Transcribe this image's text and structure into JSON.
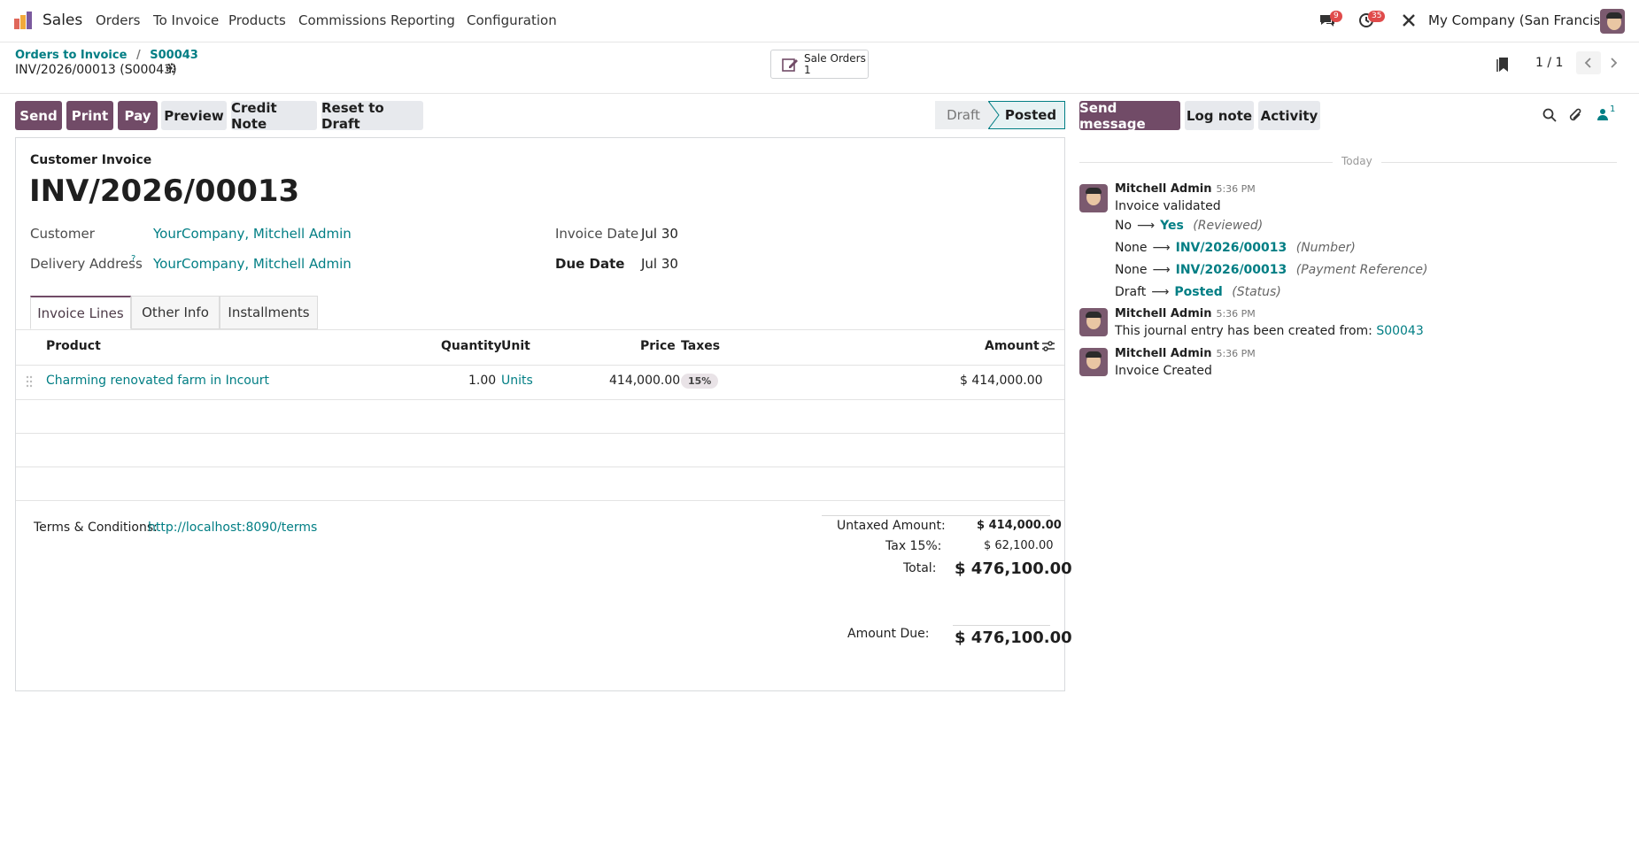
{
  "navbar": {
    "app_name": "Sales",
    "menu": [
      "Orders",
      "To Invoice",
      "Products",
      "Commissions",
      "Reporting",
      "Configuration"
    ],
    "messages_badge": "9",
    "activity_badge": "35",
    "company": "My Company (San Francisco)"
  },
  "breadcrumb": {
    "root": "Orders to Invoice",
    "separator": "/",
    "parent": "S00043",
    "current": "INV/2026/00013 (S00043)"
  },
  "smart_button": {
    "label": "Sale Orders",
    "count": "1"
  },
  "pager": {
    "value": "1 / 1"
  },
  "actions": {
    "send": "Send",
    "print": "Print",
    "pay": "Pay",
    "preview": "Preview",
    "credit_note": "Credit Note",
    "reset": "Reset to Draft"
  },
  "statusbar": {
    "draft": "Draft",
    "posted": "Posted"
  },
  "form": {
    "type_label": "Customer Invoice",
    "name": "INV/2026/00013",
    "customer_label": "Customer",
    "customer": "YourCompany, Mitchell Admin",
    "delivery_label": "Delivery Address",
    "delivery_help": "?",
    "delivery": "YourCompany, Mitchell Admin",
    "invoice_date_label": "Invoice Date",
    "invoice_date": "Jul 30",
    "due_date_label": "Due Date",
    "due_date": "Jul 30"
  },
  "tabs": [
    "Invoice Lines",
    "Other Info",
    "Installments"
  ],
  "lines": {
    "headers": {
      "product": "Product",
      "quantity": "Quantity",
      "unit": "Unit",
      "price": "Price",
      "taxes": "Taxes",
      "amount": "Amount"
    },
    "rows": [
      {
        "product": "Charming renovated farm in Incourt",
        "quantity": "1.00",
        "unit": "Units",
        "price": "414,000.00",
        "tax": "15%",
        "amount": "$ 414,000.00"
      }
    ]
  },
  "terms": {
    "label": "Terms & Conditions:",
    "link": "http://localhost:8090/terms"
  },
  "totals": {
    "untaxed_label": "Untaxed Amount:",
    "untaxed": "$ 414,000.00",
    "tax_label": "Tax 15%:",
    "tax": "$ 62,100.00",
    "total_label": "Total:",
    "total": "$ 476,100.00",
    "due_label": "Amount Due:",
    "due": "$ 476,100.00"
  },
  "chatter": {
    "send_message": "Send message",
    "log_note": "Log note",
    "activity": "Activity",
    "followers_count": "1",
    "day": "Today",
    "messages": [
      {
        "author": "Mitchell Admin",
        "time": "5:36 PM",
        "body": "Invoice validated",
        "tracking": [
          {
            "old": "No",
            "new": "Yes",
            "field": "(Reviewed)"
          },
          {
            "old": "None",
            "new": "INV/2026/00013",
            "field": "(Number)"
          },
          {
            "old": "None",
            "new": "INV/2026/00013",
            "field": "(Payment Reference)"
          },
          {
            "old": "Draft",
            "new": "Posted",
            "field": "(Status)"
          }
        ]
      },
      {
        "author": "Mitchell Admin",
        "time": "5:36 PM",
        "body": "This journal entry has been created from:",
        "link": "S00043"
      },
      {
        "author": "Mitchell Admin",
        "time": "5:36 PM",
        "body": "Invoice Created"
      }
    ]
  },
  "colors": {
    "primary": "#714b67",
    "link": "#017e84",
    "badge": "#e04b4b"
  }
}
